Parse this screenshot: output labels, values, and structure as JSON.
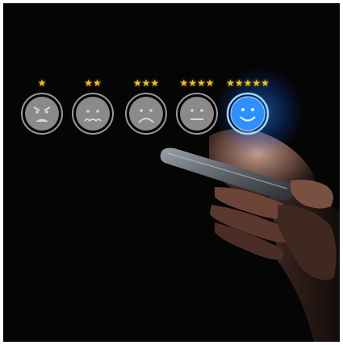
{
  "image": {
    "background_color": "#050505",
    "accent_blue": "#3aa0ff",
    "star_color": "#f2c21a",
    "face_gray": "#8a8a8a"
  },
  "ratings": [
    {
      "stars": "★",
      "face": "angry-face-icon",
      "level": 1
    },
    {
      "stars": "★★",
      "face": "worried-face-icon",
      "level": 2
    },
    {
      "stars": "★★★",
      "face": "sad-face-icon",
      "level": 3
    },
    {
      "stars": "★★★★",
      "face": "neutral-face-icon",
      "level": 4
    },
    {
      "stars": "★★★★★",
      "face": "smiling-face-icon",
      "level": 5,
      "highlighted": true
    }
  ]
}
